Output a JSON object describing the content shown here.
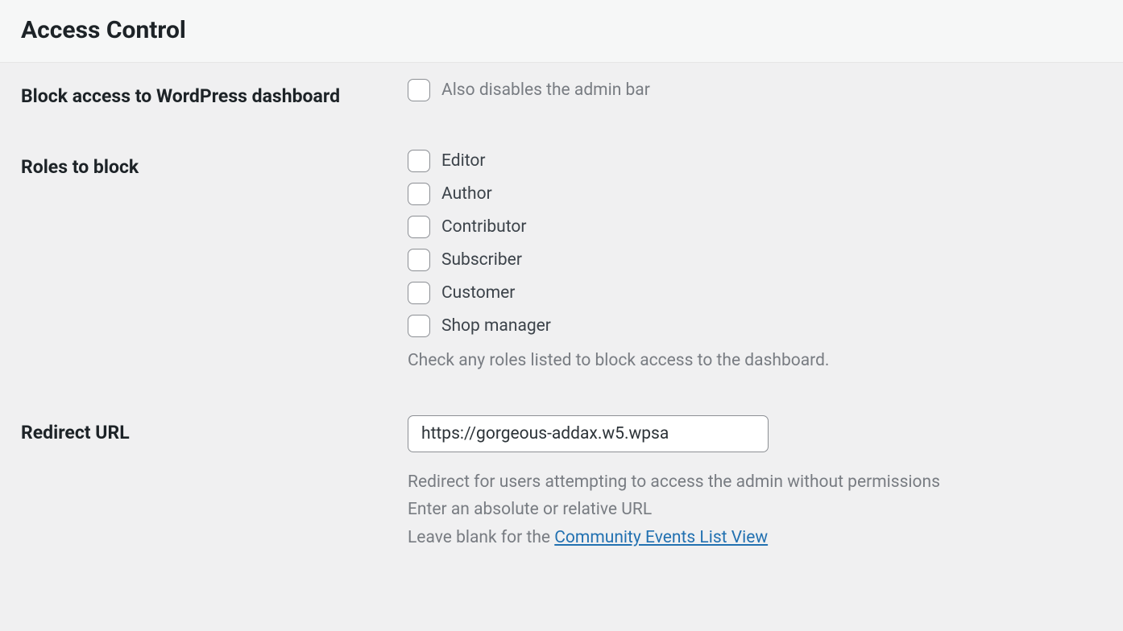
{
  "header": {
    "title": "Access Control"
  },
  "settings": {
    "blockAccess": {
      "label": "Block access to WordPress dashboard",
      "checkboxLabel": "Also disables the admin bar"
    },
    "rolesToBlock": {
      "label": "Roles to block",
      "roles": [
        "Editor",
        "Author",
        "Contributor",
        "Subscriber",
        "Customer",
        "Shop manager"
      ],
      "helpText": "Check any roles listed to block access to the dashboard."
    },
    "redirectUrl": {
      "label": "Redirect URL",
      "value": "https://gorgeous-addax.w5.wpsa",
      "help1": "Redirect for users attempting to access the admin without permissions",
      "help2": "Enter an absolute or relative URL",
      "help3prefix": "Leave blank for the ",
      "help3link": "Community Events List View"
    }
  }
}
